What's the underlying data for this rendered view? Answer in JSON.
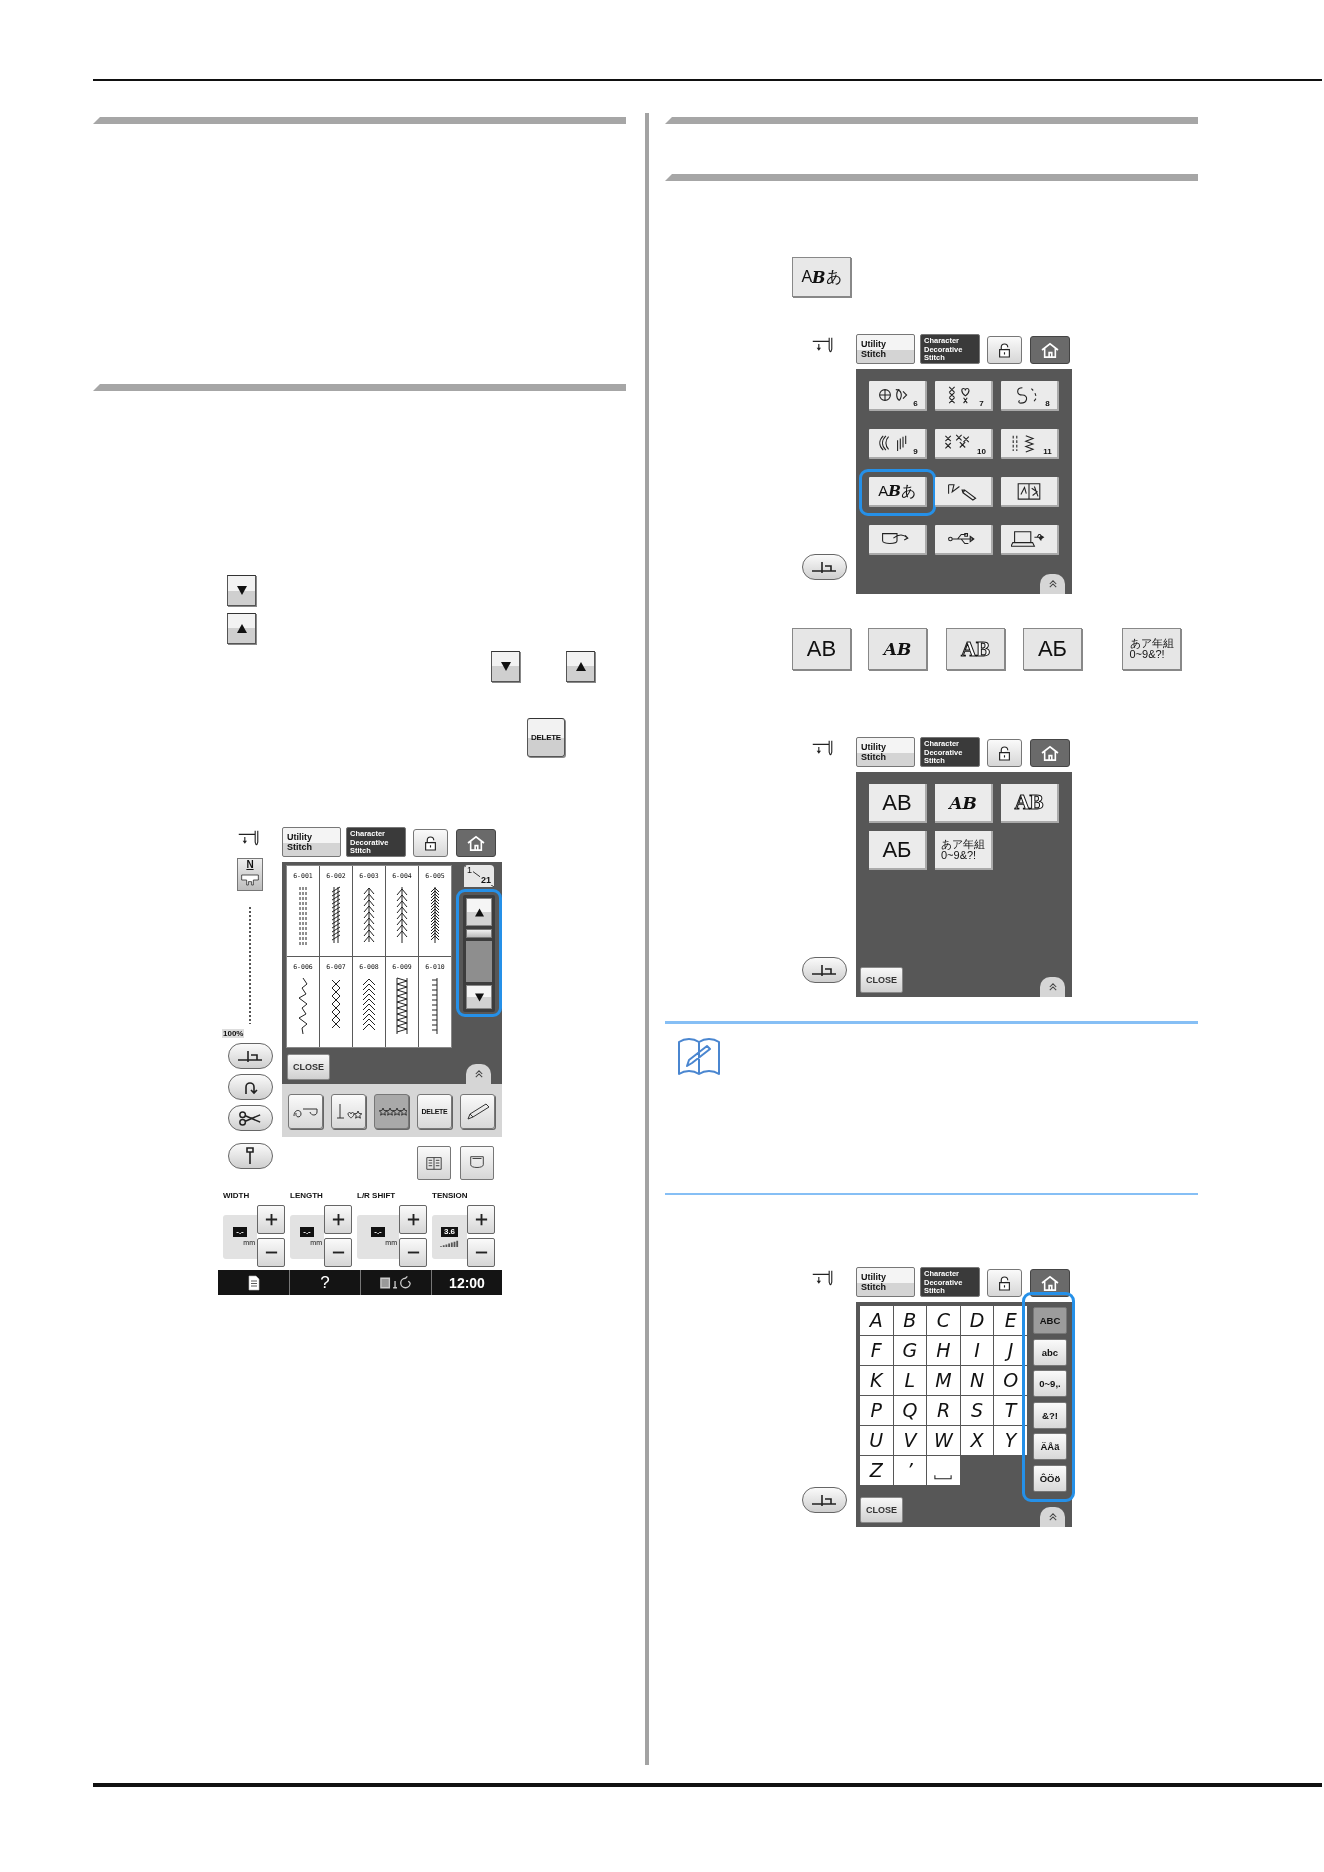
{
  "left_column": [
    {
      "kind": "heading_rule"
    },
    {
      "kind": "heading_rule"
    },
    {
      "kind": "key_row",
      "keys": [
        {
          "kind": "scroll_down"
        }
      ]
    },
    {
      "kind": "key_row",
      "keys": [
        {
          "kind": "scroll_up"
        }
      ]
    },
    {
      "kind": "key_row",
      "keys": [
        {
          "kind": "scroll_down"
        },
        {
          "kind": "scroll_up"
        }
      ]
    },
    {
      "kind": "key_row",
      "keys": [
        {
          "kind": "label",
          "label": "DELETE"
        }
      ]
    },
    {
      "kind": "screen",
      "screen": {
        "kind": "stitch_list",
        "tabs": [
          {
            "label": "Utility Stitch",
            "selected": false
          },
          {
            "label": "Character Decorative Stitch",
            "selected": true
          }
        ],
        "presser_foot": "N",
        "zoom": "100%",
        "side_buttons": [
          {
            "kind": "presser_foot"
          },
          {
            "kind": "reverse"
          },
          {
            "kind": "scissors"
          },
          {
            "kind": "needle_position"
          }
        ],
        "stitches": [
          {
            "code": "6-001",
            "kind": "triple"
          },
          {
            "code": "6-002",
            "kind": "rope"
          },
          {
            "code": "6-003",
            "kind": "arrows"
          },
          {
            "code": "6-004",
            "kind": "feather"
          },
          {
            "code": "6-005",
            "kind": "herringbone"
          },
          {
            "code": "6-006",
            "kind": "step"
          },
          {
            "code": "6-007",
            "kind": "cross"
          },
          {
            "code": "6-008",
            "kind": "chevron"
          },
          {
            "code": "6-009",
            "kind": "band"
          },
          {
            "code": "6-010",
            "kind": "ladder"
          }
        ],
        "page": {
          "current": "1",
          "total": "21"
        },
        "scroll": {
          "highlighted": true
        },
        "close": "CLOSE",
        "toolbar": [
          {
            "kind": "mirror",
            "selected": false
          },
          {
            "kind": "pattern_stars",
            "selected": false
          },
          {
            "kind": "stars",
            "selected": true
          },
          {
            "kind": "label",
            "label": "DELETE",
            "selected": false
          },
          {
            "kind": "pencil",
            "selected": false
          }
        ],
        "extra_buttons": [
          {
            "kind": "book"
          },
          {
            "kind": "pocket"
          }
        ],
        "settings": [
          {
            "kind": "value",
            "label": "WIDTH",
            "value": "-.-",
            "unit": "mm"
          },
          {
            "kind": "value",
            "label": "LENGTH",
            "value": "-.-",
            "unit": "mm"
          },
          {
            "kind": "value",
            "label": "L/R SHIFT",
            "value": "-.-",
            "unit": "mm"
          },
          {
            "kind": "tension",
            "label": "TENSION",
            "value": "3.6"
          }
        ],
        "status_bar": [
          {
            "kind": "document"
          },
          {
            "kind": "label",
            "label": "?"
          },
          {
            "kind": "machine"
          },
          {
            "kind": "clock",
            "label": "12:00"
          }
        ]
      }
    }
  ],
  "right_column": [
    {
      "kind": "heading_rule"
    },
    {
      "kind": "heading_rule"
    },
    {
      "kind": "key_row",
      "keys": [
        {
          "kind": "font_label",
          "parts": [
            {
              "kind": "plain",
              "text": "A"
            },
            {
              "kind": "script",
              "text": "B"
            },
            {
              "kind": "plain",
              "text": "あ"
            }
          ]
        }
      ]
    },
    {
      "kind": "screen",
      "screen": {
        "kind": "category_menu",
        "tabs": [
          {
            "label": "Utility Stitch",
            "selected": false
          },
          {
            "label": "Character Decorative Stitch",
            "selected": true
          }
        ],
        "side_buttons": [
          {
            "kind": "presser_foot"
          }
        ],
        "categories": [
          {
            "kind": "floral",
            "number": "6",
            "highlighted": false
          },
          {
            "kind": "heart",
            "number": "7",
            "highlighted": false
          },
          {
            "kind": "swirl",
            "number": "8",
            "highlighted": false
          },
          {
            "kind": "satin",
            "number": "9",
            "highlighted": false
          },
          {
            "kind": "cross",
            "number": "10",
            "highlighted": false
          },
          {
            "kind": "zigzag",
            "number": "11",
            "highlighted": false
          },
          {
            "kind": "text",
            "parts": [
              {
                "kind": "plain",
                "text": "A"
              },
              {
                "kind": "script",
                "text": "B"
              },
              {
                "kind": "plain",
                "text": "あ"
              }
            ],
            "highlighted": true
          },
          {
            "kind": "draw",
            "highlighted": false
          },
          {
            "kind": "book",
            "highlighted": false
          },
          {
            "kind": "pocket",
            "highlighted": false
          },
          {
            "kind": "usb",
            "highlighted": false
          },
          {
            "kind": "computer",
            "highlighted": false
          }
        ]
      }
    },
    {
      "kind": "font_row",
      "fonts": [
        {
          "kind": "sans",
          "lines": [
            "AB"
          ]
        },
        {
          "kind": "script",
          "lines": [
            "AB"
          ]
        },
        {
          "kind": "outline",
          "lines": [
            "AB"
          ]
        },
        {
          "kind": "sans",
          "lines": [
            "АБ"
          ]
        },
        {
          "kind": "kana",
          "lines": [
            "あア年組",
            "0~9&?!"
          ]
        }
      ]
    },
    {
      "kind": "screen",
      "screen": {
        "kind": "font_menu",
        "tabs": [
          {
            "label": "Utility Stitch",
            "selected": false
          },
          {
            "label": "Character Decorative Stitch",
            "selected": true
          }
        ],
        "side_buttons": [
          {
            "kind": "presser_foot"
          }
        ],
        "fonts": [
          {
            "kind": "sans",
            "lines": [
              "AB"
            ]
          },
          {
            "kind": "script",
            "lines": [
              "AB"
            ]
          },
          {
            "kind": "outline",
            "lines": [
              "AB"
            ]
          },
          {
            "kind": "sans",
            "lines": [
              "АБ"
            ]
          },
          {
            "kind": "kana",
            "lines": [
              "あア年組",
              "0~9&?!"
            ]
          }
        ],
        "close": "CLOSE"
      }
    },
    {
      "kind": "note"
    },
    {
      "kind": "screen",
      "screen": {
        "kind": "letter_keyboard",
        "tabs": [
          {
            "label": "Utility Stitch",
            "selected": false
          },
          {
            "label": "Character Decorative Stitch",
            "selected": true
          }
        ],
        "side_buttons": [
          {
            "kind": "presser_foot"
          }
        ],
        "keys": [
          {
            "kind": "char",
            "label": "A"
          },
          {
            "kind": "char",
            "label": "B"
          },
          {
            "kind": "char",
            "label": "C"
          },
          {
            "kind": "char",
            "label": "D"
          },
          {
            "kind": "char",
            "label": "E"
          },
          {
            "kind": "char",
            "label": "F"
          },
          {
            "kind": "char",
            "label": "G"
          },
          {
            "kind": "char",
            "label": "H"
          },
          {
            "kind": "char",
            "label": "I"
          },
          {
            "kind": "char",
            "label": "J"
          },
          {
            "kind": "char",
            "label": "K"
          },
          {
            "kind": "char",
            "label": "L"
          },
          {
            "kind": "char",
            "label": "M"
          },
          {
            "kind": "char",
            "label": "N"
          },
          {
            "kind": "char",
            "label": "O"
          },
          {
            "kind": "char",
            "label": "P"
          },
          {
            "kind": "char",
            "label": "Q"
          },
          {
            "kind": "char",
            "label": "R"
          },
          {
            "kind": "char",
            "label": "S"
          },
          {
            "kind": "char",
            "label": "T"
          },
          {
            "kind": "char",
            "label": "U"
          },
          {
            "kind": "char",
            "label": "V"
          },
          {
            "kind": "char",
            "label": "W"
          },
          {
            "kind": "char",
            "label": "X"
          },
          {
            "kind": "char",
            "label": "Y"
          },
          {
            "kind": "char",
            "label": "Z"
          },
          {
            "kind": "char",
            "label": "’"
          },
          {
            "kind": "space"
          }
        ],
        "modes": {
          "highlighted": true,
          "items": [
            {
              "label": "ABC",
              "selected": true
            },
            {
              "label": "abc",
              "selected": false
            },
            {
              "label": "0~9,.",
              "selected": false
            },
            {
              "label": "&?!",
              "selected": false
            },
            {
              "label": "ÄÅä",
              "selected": false
            },
            {
              "label": "ÔÖö",
              "selected": false
            }
          ]
        },
        "close": "CLOSE"
      }
    }
  ]
}
